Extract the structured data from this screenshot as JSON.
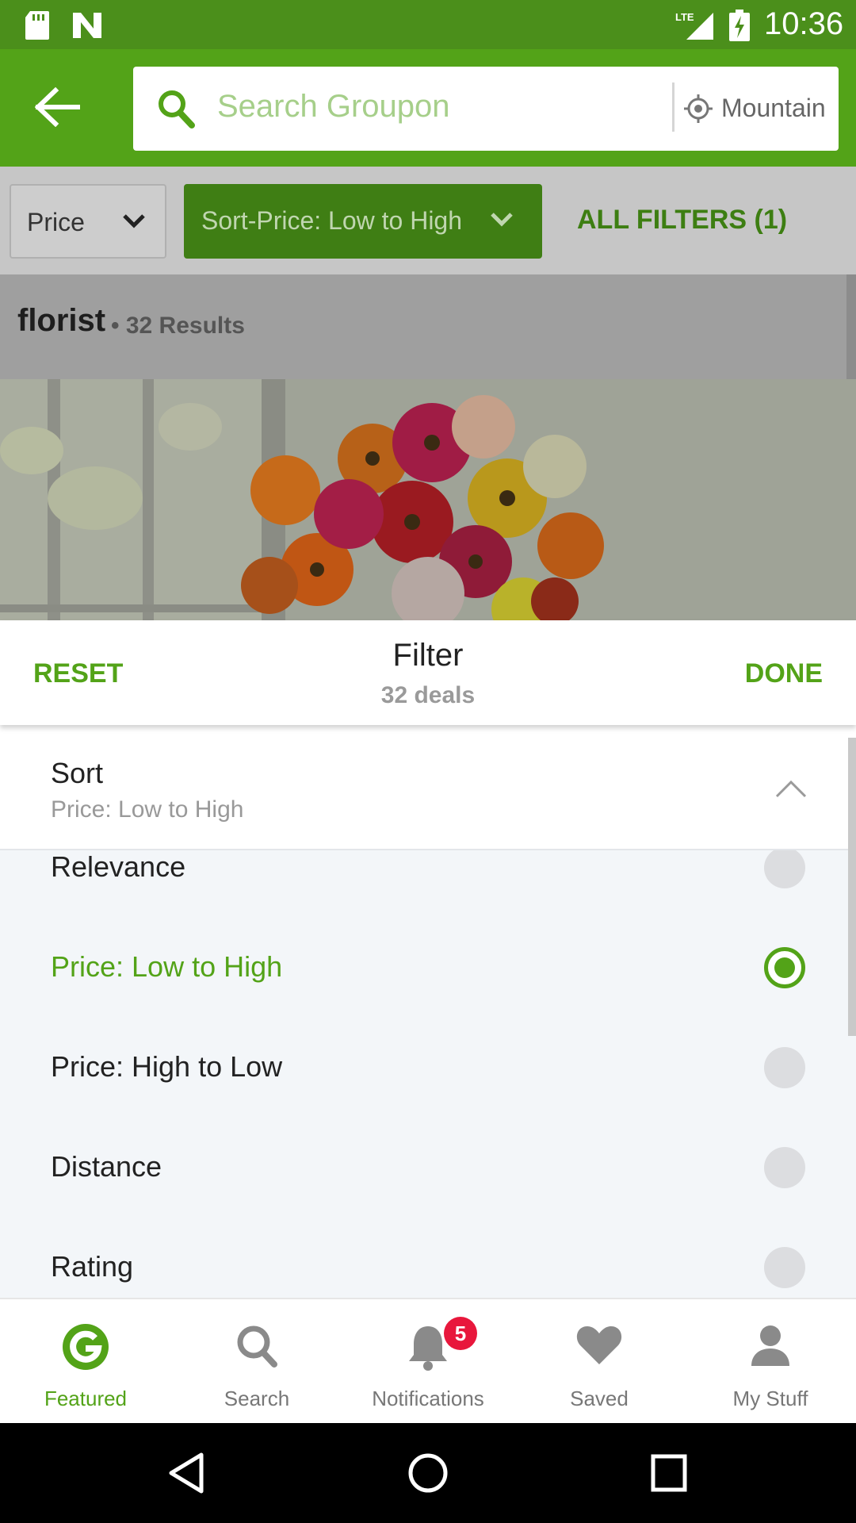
{
  "status_bar": {
    "time": "10:36"
  },
  "header": {
    "search_placeholder": "Search Groupon",
    "location": "Mountain View"
  },
  "filters": {
    "price_label": "Price",
    "sort_label": "Sort-Price: Low to High",
    "all_filters_label": "ALL FILTERS (1)"
  },
  "results": {
    "query": "florist",
    "count_text": "• 32 Results"
  },
  "sheet": {
    "reset_label": "RESET",
    "title": "Filter",
    "subtitle": "32 deals",
    "done_label": "DONE",
    "section_title": "Sort",
    "section_value": "Price: Low to High",
    "options": [
      {
        "label": "Relevance",
        "selected": false
      },
      {
        "label": "Price: Low to High",
        "selected": true
      },
      {
        "label": "Price: High to Low",
        "selected": false
      },
      {
        "label": "Distance",
        "selected": false
      },
      {
        "label": "Rating",
        "selected": false
      }
    ]
  },
  "bottom_nav": {
    "items": [
      {
        "label": "Featured",
        "icon": "groupon-g-icon",
        "active": true
      },
      {
        "label": "Search",
        "icon": "search-icon",
        "active": false
      },
      {
        "label": "Notifications",
        "icon": "bell-icon",
        "active": false,
        "badge": "5"
      },
      {
        "label": "Saved",
        "icon": "heart-icon",
        "active": false
      },
      {
        "label": "My Stuff",
        "icon": "person-icon",
        "active": false
      }
    ]
  },
  "colors": {
    "brand_green": "#53a318",
    "status_green": "#4b8f1b",
    "badge_red": "#e8173c"
  }
}
